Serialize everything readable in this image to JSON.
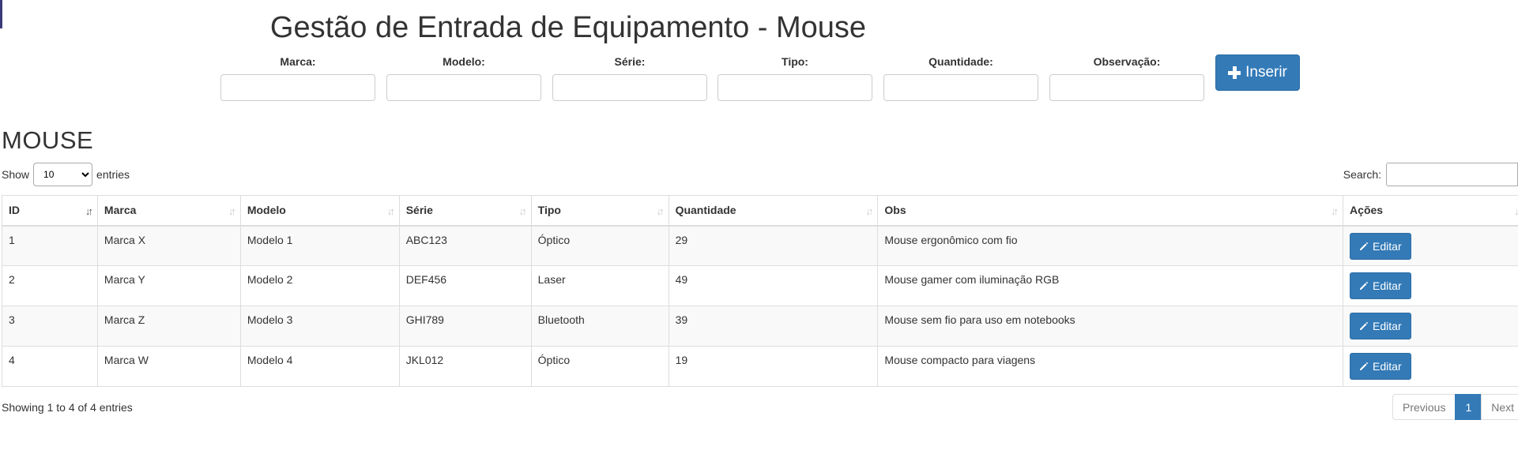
{
  "page": {
    "title": "Gestão de Entrada de Equipamento - Mouse",
    "accent_color": "#337ab7"
  },
  "form": {
    "fields": [
      {
        "label": "Marca:",
        "value": "",
        "placeholder": ""
      },
      {
        "label": "Modelo:",
        "value": "",
        "placeholder": ""
      },
      {
        "label": "Série:",
        "value": "",
        "placeholder": ""
      },
      {
        "label": "Tipo:",
        "value": "",
        "placeholder": ""
      },
      {
        "label": "Quantidade:",
        "value": "",
        "placeholder": ""
      },
      {
        "label": "Observação:",
        "value": "",
        "placeholder": ""
      }
    ],
    "insert_label": "Inserir",
    "insert_icon": "plus-icon"
  },
  "section": {
    "title": "MOUSE"
  },
  "table_controls": {
    "show_label": "Show",
    "page_length": "10",
    "entries_label": "entries",
    "search_label": "Search:",
    "search_value": ""
  },
  "table": {
    "columns": [
      "ID",
      "Marca",
      "Modelo",
      "Série",
      "Tipo",
      "Quantidade",
      "Obs",
      "Ações"
    ],
    "sorted_column": "ID",
    "rows": [
      {
        "id": "1",
        "marca": "Marca X",
        "modelo": "Modelo 1",
        "serie": "ABC123",
        "tipo": "Óptico",
        "quantidade": "29",
        "obs": "Mouse ergonômico com fio",
        "action": "Editar"
      },
      {
        "id": "2",
        "marca": "Marca Y",
        "modelo": "Modelo 2",
        "serie": "DEF456",
        "tipo": "Laser",
        "quantidade": "49",
        "obs": "Mouse gamer com iluminação RGB",
        "action": "Editar"
      },
      {
        "id": "3",
        "marca": "Marca Z",
        "modelo": "Modelo 3",
        "serie": "GHI789",
        "tipo": "Bluetooth",
        "quantidade": "39",
        "obs": "Mouse sem fio para uso em notebooks",
        "action": "Editar"
      },
      {
        "id": "4",
        "marca": "Marca W",
        "modelo": "Modelo 4",
        "serie": "JKL012",
        "tipo": "Óptico",
        "quantidade": "19",
        "obs": "Mouse compacto para viagens",
        "action": "Editar"
      }
    ]
  },
  "footer": {
    "info": "Showing 1 to 4 of 4 entries",
    "previous_label": "Previous",
    "current_page": "1",
    "next_label": "Next"
  }
}
